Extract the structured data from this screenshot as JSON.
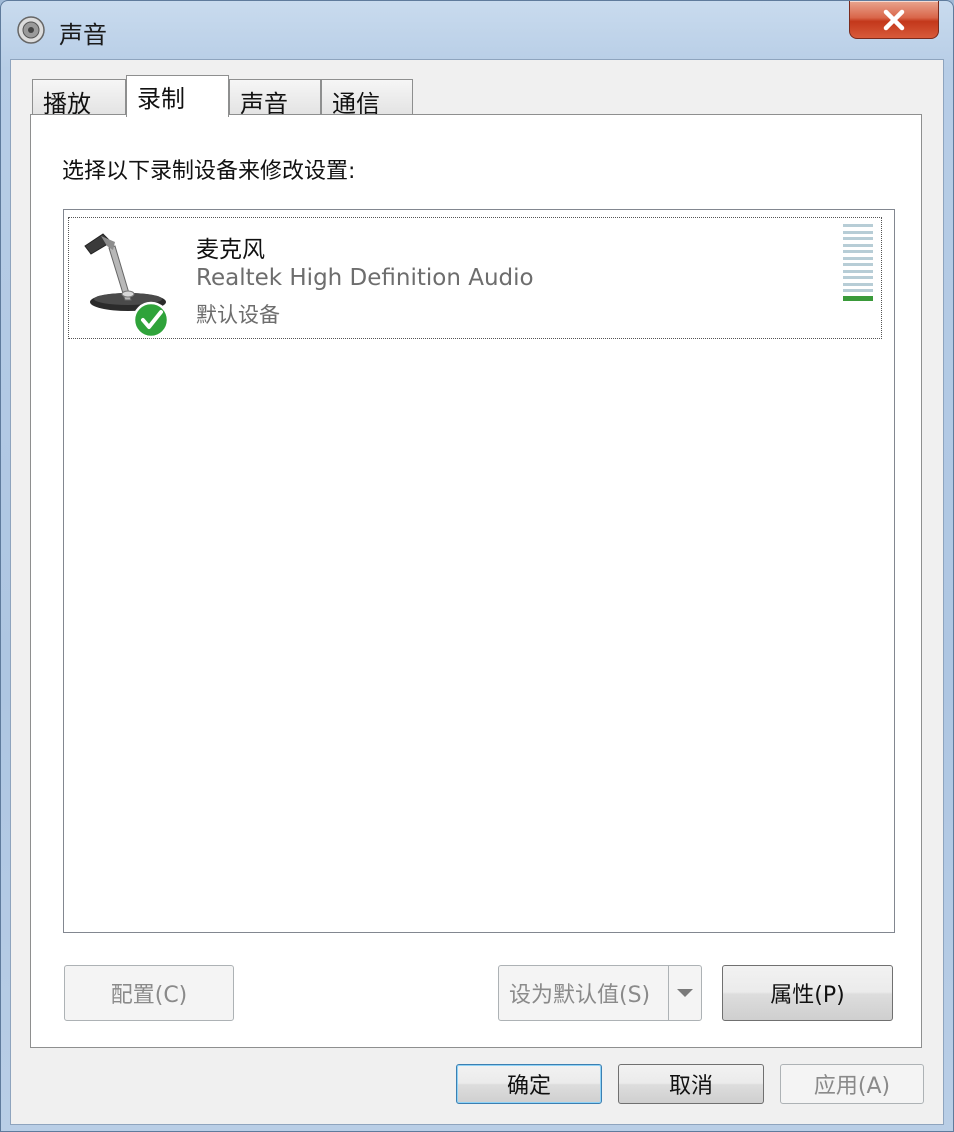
{
  "window": {
    "title": "声音",
    "icon": "speaker-icon",
    "close_icon": "close-icon"
  },
  "tabs": [
    {
      "label": "播放",
      "active": false
    },
    {
      "label": "录制",
      "active": true
    },
    {
      "label": "声音",
      "active": false
    },
    {
      "label": "通信",
      "active": false
    }
  ],
  "recording": {
    "instruction": "选择以下录制设备来修改设置:",
    "devices": [
      {
        "name": "麦克风",
        "driver": "Realtek High Definition Audio",
        "status": "默认设备",
        "icon": "microphone-icon",
        "badge": "default-check-icon",
        "level": 0.08
      }
    ],
    "buttons": {
      "configure": "配置(C)",
      "set_default": "设为默认值(S)",
      "properties": "属性(P)"
    }
  },
  "footer": {
    "ok": "确定",
    "cancel": "取消",
    "apply": "应用(A)"
  },
  "colors": {
    "selection_check": "#2fa33a",
    "level_on": "#3a9a3a",
    "close_red": "#c3381b"
  }
}
